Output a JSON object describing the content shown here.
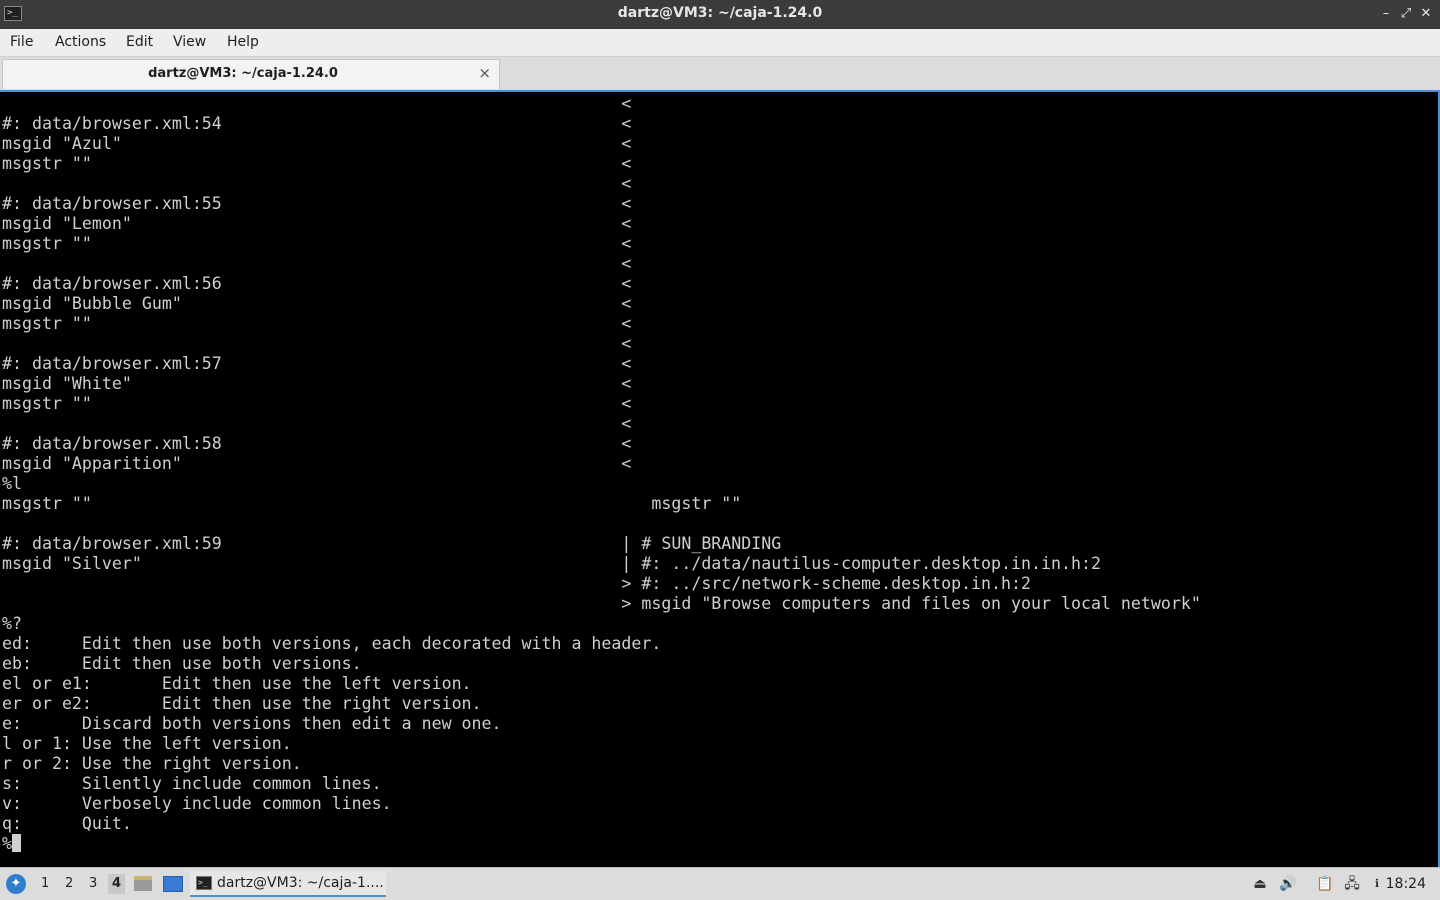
{
  "window": {
    "title": "dartz@VM3: ~/caja-1.24.0",
    "app_icon": "terminal-icon",
    "controls": {
      "minimize": "–",
      "maximize": "⤢",
      "close": "✕"
    }
  },
  "menu": {
    "file": "File",
    "actions": "Actions",
    "edit": "Edit",
    "view": "View",
    "help": "Help"
  },
  "tab": {
    "label": "dartz@VM3: ~/caja-1.24.0",
    "close": "×"
  },
  "terminal": {
    "content": "                                                              <\n#: data/browser.xml:54                                        <\nmsgid \"Azul\"                                                  <\nmsgstr \"\"                                                     <\n                                                              <\n#: data/browser.xml:55                                        <\nmsgid \"Lemon\"                                                 <\nmsgstr \"\"                                                     <\n                                                              <\n#: data/browser.xml:56                                        <\nmsgid \"Bubble Gum\"                                            <\nmsgstr \"\"                                                     <\n                                                              <\n#: data/browser.xml:57                                        <\nmsgid \"White\"                                                 <\nmsgstr \"\"                                                     <\n                                                              <\n#: data/browser.xml:58                                        <\nmsgid \"Apparition\"                                            <\n%l\nmsgstr \"\"                                                        msgstr \"\"\n\n#: data/browser.xml:59                                        | # SUN_BRANDING\nmsgid \"Silver\"                                                | #: ../data/nautilus-computer.desktop.in.in.h:2\n                                                              > #: ../src/network-scheme.desktop.in.h:2\n                                                              > msgid \"Browse computers and files on your local network\"\n%?\ned:     Edit then use both versions, each decorated with a header.\neb:     Edit then use both versions.\nel or e1:       Edit then use the left version.\ner or e2:       Edit then use the right version.\ne:      Discard both versions then edit a new one.\nl or 1: Use the left version.\nr or 2: Use the right version.\ns:      Silently include common lines.\nv:      Verbosely include common lines.\nq:      Quit.\n%"
  },
  "taskbar": {
    "start_icon": "lubuntu-logo-icon",
    "workspaces": [
      "1",
      "2",
      "3",
      "4"
    ],
    "active_workspace": "4",
    "task_label": "dartz@VM3: ~/caja-1....",
    "clock": "18:24",
    "tray_icons": [
      "eject-icon",
      "volume-icon",
      "clipboard-icon",
      "network-icon",
      "notification-icon"
    ]
  }
}
